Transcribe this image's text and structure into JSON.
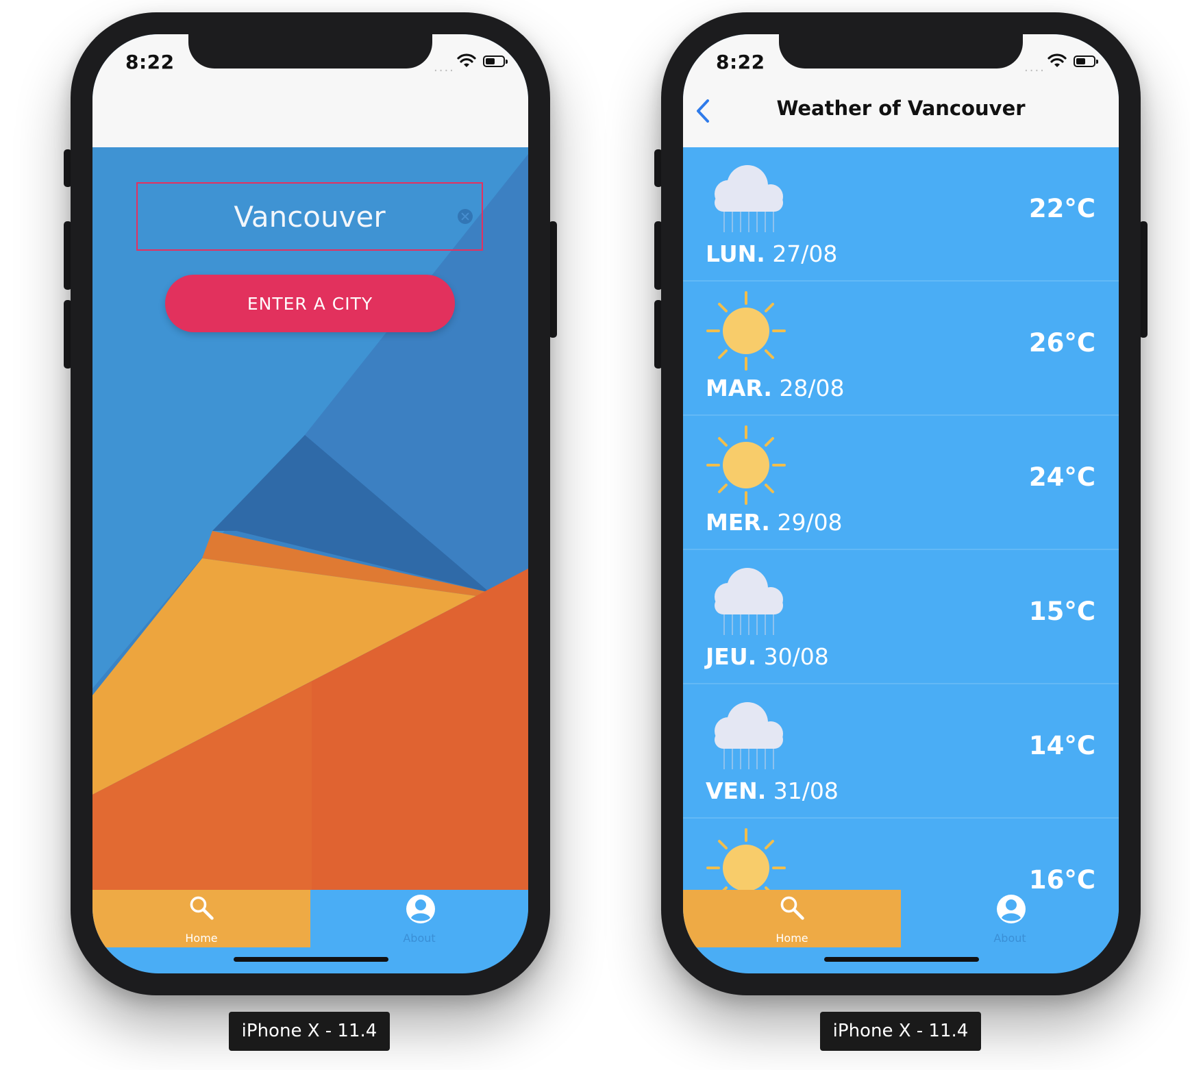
{
  "devices": [
    {
      "status_time": "8:22",
      "search": {
        "input_value": "Vancouver",
        "button_label": "ENTER A CITY"
      },
      "tabs": [
        {
          "label": "Home",
          "icon": "search-icon",
          "active": true
        },
        {
          "label": "About",
          "icon": "user-circle-icon",
          "active": false
        }
      ],
      "caption": "iPhone X - 11.4"
    },
    {
      "status_time": "8:22",
      "nav_title": "Weather of Vancouver",
      "forecast": [
        {
          "day": "LUN.",
          "date": "27/08",
          "temp": "22°C",
          "icon": "rain-cloud-icon"
        },
        {
          "day": "MAR.",
          "date": "28/08",
          "temp": "26°C",
          "icon": "sun-icon"
        },
        {
          "day": "MER.",
          "date": "29/08",
          "temp": "24°C",
          "icon": "sun-icon"
        },
        {
          "day": "JEU.",
          "date": "30/08",
          "temp": "15°C",
          "icon": "rain-cloud-icon"
        },
        {
          "day": "VEN.",
          "date": "31/08",
          "temp": "14°C",
          "icon": "rain-cloud-icon"
        },
        {
          "temp": "16°C",
          "icon": "sun-icon"
        }
      ],
      "tabs": [
        {
          "label": "Home",
          "icon": "search-icon",
          "active": true
        },
        {
          "label": "About",
          "icon": "user-circle-icon",
          "active": false
        }
      ],
      "caption": "iPhone X - 11.4"
    }
  ],
  "colors": {
    "accent_pink": "#e2315d",
    "sky_blue": "#4aadf5",
    "tab_active": "#eeaa45",
    "sun": "#f8cc6a",
    "cloud": "#e4e7f3"
  }
}
